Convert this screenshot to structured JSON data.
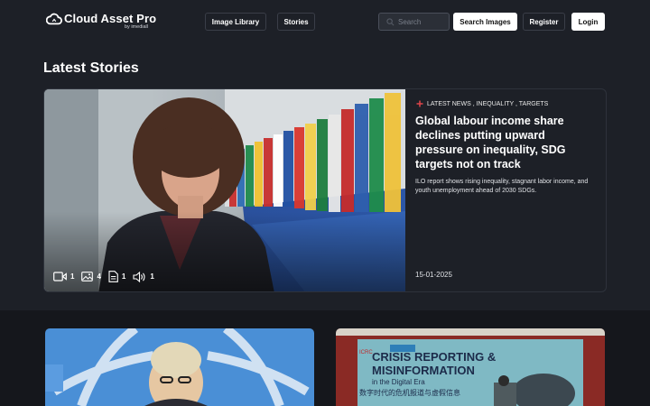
{
  "header": {
    "logo_title": "Cloud Asset Pro",
    "logo_sub": "by imediall",
    "nav": [
      {
        "label": "Image Library"
      },
      {
        "label": "Stories"
      }
    ],
    "search_placeholder": "Search",
    "search_button": "Search Images",
    "register": "Register",
    "login": "Login"
  },
  "section_title": "Latest Stories",
  "featured": {
    "tags": "LATEST NEWS , INEQUALITY , TARGETS",
    "title": "Global labour income share declines putting upward pressure on inequality, SDG targets not on track",
    "description": "ILO report shows rising inequality, stagnant labor income, and youth unemployment ahead of 2030 SDGs.",
    "date": "15-01-2025",
    "media": [
      {
        "icon": "video-icon",
        "count": "1"
      },
      {
        "icon": "image-icon",
        "count": "4"
      },
      {
        "icon": "document-icon",
        "count": "1"
      },
      {
        "icon": "audio-icon",
        "count": "1"
      }
    ]
  },
  "story2": {
    "banner_line1": "CRISIS REPORTING &",
    "banner_line2": "MISINFORMATION",
    "banner_line3": "in the Digital Era",
    "banner_cn": "数字时代的危机报道与虚假信息",
    "org": "ICRC"
  },
  "colors": {
    "background": "#1d2027",
    "accent_tag": "#e0454a",
    "lower_bg": "#15171c"
  }
}
